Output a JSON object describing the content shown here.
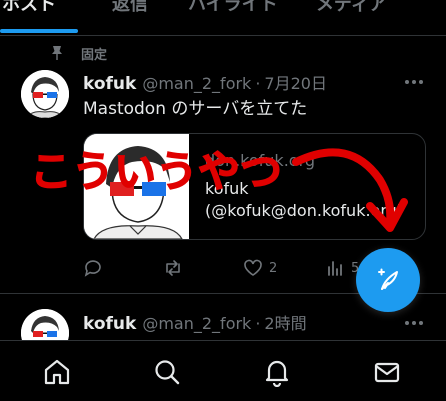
{
  "tabs": [
    {
      "label": "ホスト",
      "active": true
    },
    {
      "label": "返信",
      "active": false
    },
    {
      "label": "ハイライト",
      "active": false
    },
    {
      "label": "メディア",
      "active": false
    }
  ],
  "pinned_label": "固定",
  "posts": [
    {
      "display_name": "kofuk",
      "handle": "@man_2_fork",
      "separator": "·",
      "time": "7月20日",
      "text": "Mastodon のサーバを立てた",
      "card": {
        "domain": "don.kofuk.org",
        "title": "kofuk",
        "subtitle": "(@kofuk@don.kofuk.org)"
      },
      "reply_count": "",
      "repost_count": "",
      "like_count": "2",
      "views_count": "5"
    },
    {
      "display_name": "kofuk",
      "handle": "@man_2_fork",
      "separator": "·",
      "time": "2時間"
    }
  ],
  "annotation": {
    "text": "こういうやつ",
    "color": "#e00000"
  },
  "colors": {
    "accent": "#1d9bf0",
    "background": "#000000",
    "muted": "#71767b",
    "text": "#e7e9ea"
  },
  "icons": {
    "fab": "compose-icon",
    "nav": [
      "home-icon",
      "search-icon",
      "notifications-icon",
      "messages-icon"
    ]
  }
}
